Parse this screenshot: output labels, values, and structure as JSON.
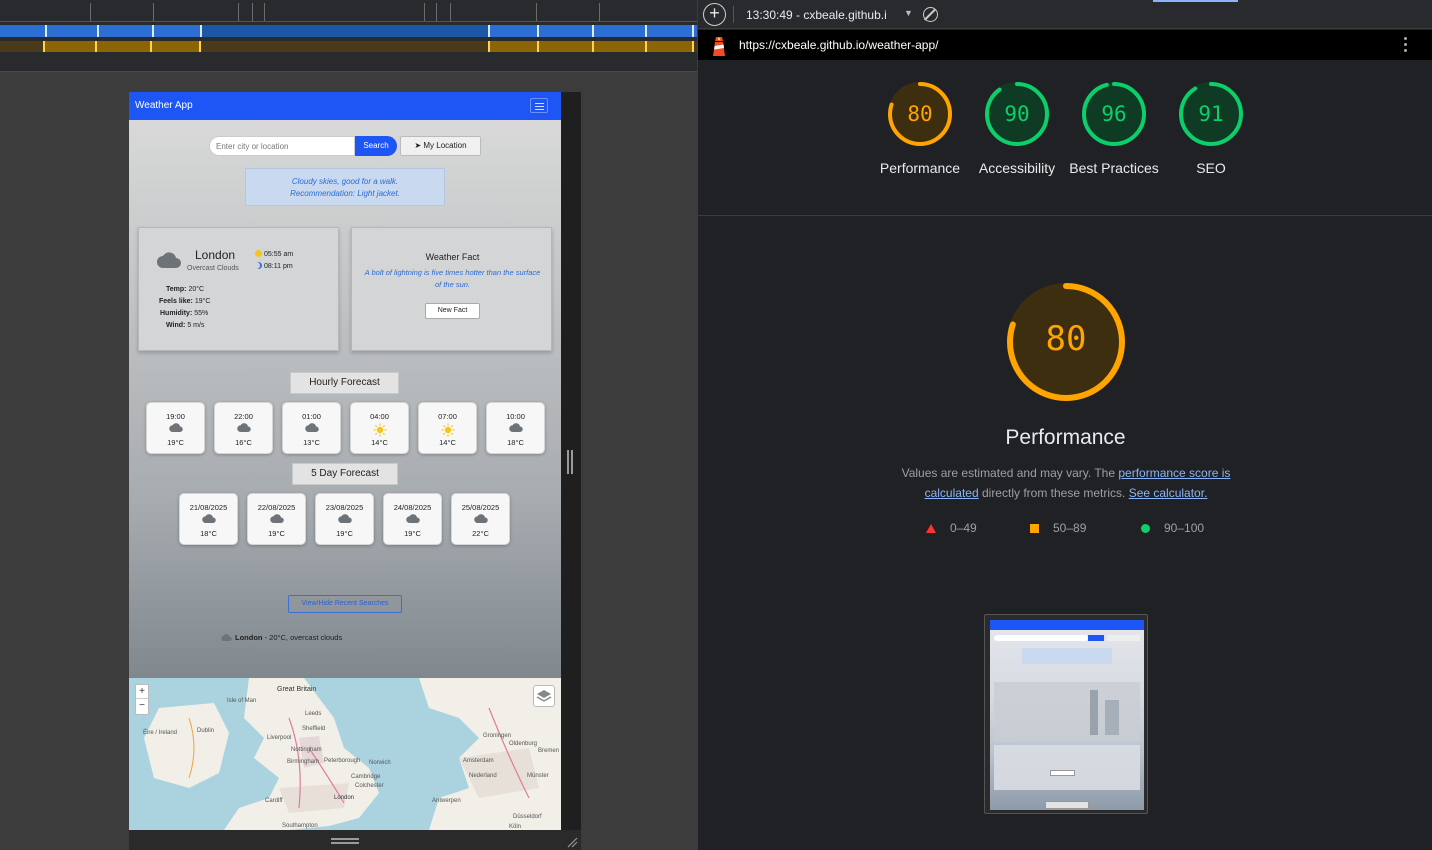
{
  "weather_app": {
    "brand": "Weather App",
    "search": {
      "placeholder": "Enter city or location",
      "button": "Search",
      "location_button": "My Location"
    },
    "advice": {
      "line1": "Cloudy skies, good for a walk.",
      "line2": "Recommendation: Light jacket."
    },
    "current": {
      "city": "London",
      "description": "Overcast Clouds",
      "sunrise": "05:55 am",
      "sunset": "08:11 pm",
      "temp_label": "Temp:",
      "temp": "20°C",
      "feels_label": "Feels like:",
      "feels": "19°C",
      "humidity_label": "Humidity:",
      "humidity": "55%",
      "wind_label": "Wind:",
      "wind": "5 m/s"
    },
    "fact": {
      "title": "Weather Fact",
      "text": "A bolt of lightning is five times hotter than the surface of the sun.",
      "button": "New Fact"
    },
    "hourly_label": "Hourly Forecast",
    "hourly": [
      {
        "time": "19:00",
        "icon": "cloud-icon",
        "temp": "19°C"
      },
      {
        "time": "22:00",
        "icon": "cloud-icon",
        "temp": "16°C"
      },
      {
        "time": "01:00",
        "icon": "cloud-icon",
        "temp": "13°C"
      },
      {
        "time": "04:00",
        "icon": "sun-icon",
        "temp": "14°C"
      },
      {
        "time": "07:00",
        "icon": "sun-icon",
        "temp": "14°C"
      },
      {
        "time": "10:00",
        "icon": "cloud-icon",
        "temp": "18°C"
      }
    ],
    "daily_label": "5 Day Forecast",
    "daily": [
      {
        "date": "21/08/2025",
        "icon": "cloud-icon",
        "temp": "18°C"
      },
      {
        "date": "22/08/2025",
        "icon": "cloud-icon",
        "temp": "19°C"
      },
      {
        "date": "23/08/2025",
        "icon": "cloud-icon",
        "temp": "19°C"
      },
      {
        "date": "24/08/2025",
        "icon": "cloud-icon",
        "temp": "19°C"
      },
      {
        "date": "25/08/2025",
        "icon": "cloud-icon",
        "temp": "22°C"
      }
    ],
    "recent_button": "View/Hide Recent Searches",
    "recent_item": {
      "city": "London",
      "detail": " - 20°C, overcast clouds"
    },
    "map": {
      "zoom_in": "+",
      "zoom_out": "−",
      "labels": [
        "Great Britain",
        "Isle of Man",
        "Leeds",
        "Dublin",
        "Sheffield",
        "Liverpool",
        "Éire / Ireland",
        "Nottingham",
        "Birmingham",
        "Peterborough",
        "Norwich",
        "Cambridge",
        "Colchester",
        "Cardiff",
        "London",
        "Southampton",
        "Groningen",
        "Oldenburg",
        "Bremen",
        "Amsterdam",
        "Nederland",
        "Münster",
        "Antwerpen",
        "Düsseldorf",
        "Köln"
      ]
    }
  },
  "devtools": {
    "report_time": "13:30:49 - cxbeale.github.i",
    "url": "https://cxbeale.github.io/weather-app/",
    "scores": [
      {
        "label": "Performance",
        "value": 80,
        "color": "#ffa400",
        "track": "#3d2e10"
      },
      {
        "label": "Accessibility",
        "value": 90,
        "color": "#0cce6b",
        "track": "#0f3b24"
      },
      {
        "label": "Best Practices",
        "value": 96,
        "color": "#0cce6b",
        "track": "#0f3b24"
      },
      {
        "label": "SEO",
        "value": 91,
        "color": "#0cce6b",
        "track": "#0f3b24"
      }
    ],
    "performance": {
      "title": "Performance",
      "score": 80,
      "note_a": "Values are estimated and may vary. The ",
      "note_link1": "performance score is calculated",
      "note_b": " directly from these metrics. ",
      "note_link2": "See calculator.",
      "legend": [
        {
          "range": "0–49",
          "shape": "triangle"
        },
        {
          "range": "50–89",
          "shape": "square"
        },
        {
          "range": "90–100",
          "shape": "circle"
        }
      ]
    }
  }
}
